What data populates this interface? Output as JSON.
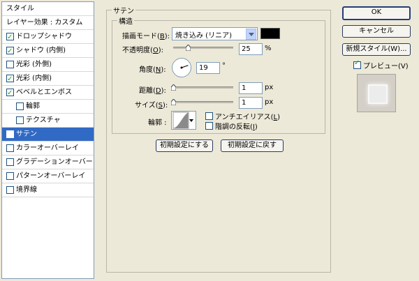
{
  "sidebar": {
    "header": "スタイル",
    "blend_options": "レイヤー効果 : カスタム",
    "items": [
      {
        "label": "ドロップシャドウ",
        "checked": true
      },
      {
        "label": "シャドウ (内側)",
        "checked": true
      },
      {
        "label": "光彩 (外側)",
        "checked": false
      },
      {
        "label": "光彩 (内側)",
        "checked": true
      },
      {
        "label": "ベベルとエンボス",
        "checked": true
      },
      {
        "label": "輪郭",
        "checked": false
      },
      {
        "label": "テクスチャ",
        "checked": false
      },
      {
        "label": "サテン",
        "checked": true,
        "selected": true
      },
      {
        "label": "カラーオーバーレイ",
        "checked": false
      },
      {
        "label": "グラデーションオーバーレイ",
        "checked": false
      },
      {
        "label": "パターンオーバーレイ",
        "checked": false
      },
      {
        "label": "境界線",
        "checked": false
      }
    ]
  },
  "satin": {
    "group_title": "サテン",
    "structure_title": "構造",
    "blend_mode_label": "描画モード(",
    "blend_mode_key": "B",
    "blend_mode_value": "焼き込み (リニア)",
    "swatch_color": "#000000",
    "opacity_label": "不透明度(",
    "opacity_key": "O",
    "opacity_value": "25",
    "opacity_unit": "%",
    "opacity_fraction": 0.25,
    "angle_label": "角度(",
    "angle_key": "N",
    "angle_value": "19",
    "angle_unit": "°",
    "distance_label": "距離(",
    "distance_key": "D",
    "distance_value": "1",
    "distance_unit": "px",
    "size_label": "サイズ(",
    "size_key": "S",
    "size_value": "1",
    "size_unit": "px",
    "contour_label": "輪郭 :",
    "antialias_label": "アンチエイリアス(",
    "antialias_key": "L",
    "invert_label": "階調の反転(",
    "invert_key": "I",
    "close_paren": "):",
    "paren_end": ")",
    "make_default_button": "初期設定にする",
    "reset_default_button": "初期設定に戻す"
  },
  "right_panel": {
    "ok_button": "OK",
    "cancel_button": "キャンセル",
    "new_style_button": "新規スタイル(W)...",
    "preview_label": "プレビュー(V)",
    "preview_checked": true
  }
}
